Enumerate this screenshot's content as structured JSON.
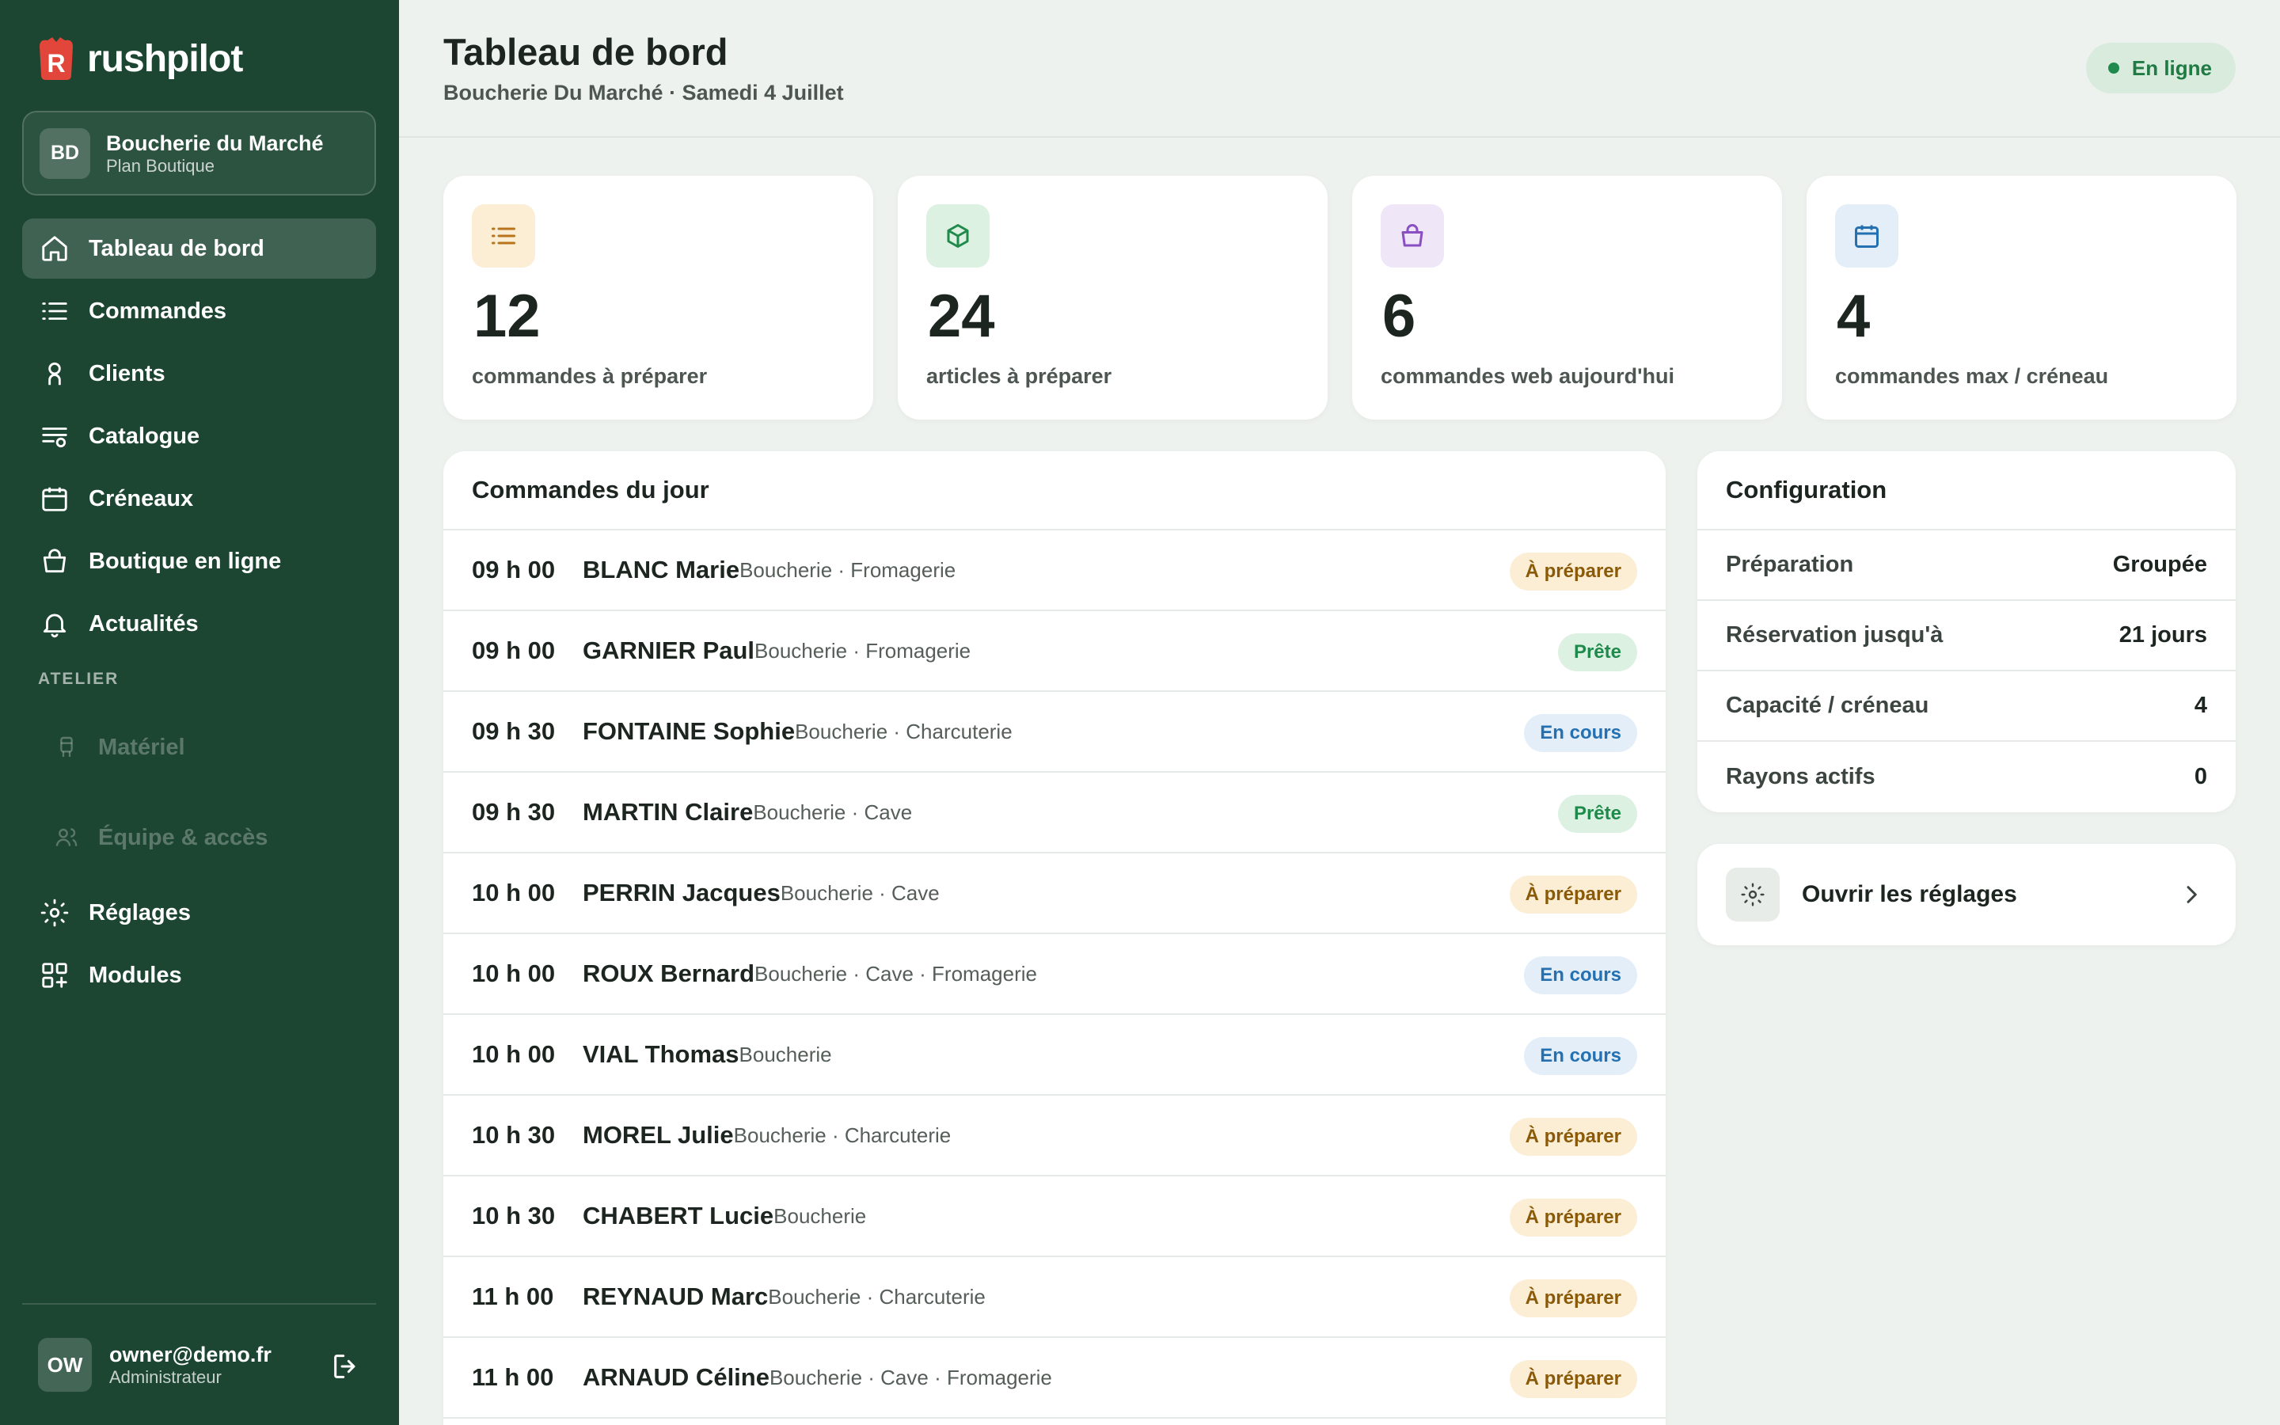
{
  "app": {
    "brand": "rushpilot"
  },
  "store": {
    "initials": "BD",
    "name": "Boucherie du Marché",
    "plan": "Plan Boutique"
  },
  "nav": {
    "items": [
      {
        "label": "Tableau de bord",
        "icon": "home-icon"
      },
      {
        "label": "Commandes",
        "icon": "list-icon"
      },
      {
        "label": "Clients",
        "icon": "user-icon"
      },
      {
        "label": "Catalogue",
        "icon": "catalog-icon"
      },
      {
        "label": "Créneaux",
        "icon": "calendar-icon"
      },
      {
        "label": "Boutique en ligne",
        "icon": "shopping-bag-icon"
      },
      {
        "label": "Actualités",
        "icon": "bell-icon"
      }
    ],
    "section": "ATELIER",
    "disabled_items": [
      {
        "label": "Matériel",
        "icon": "equipment-icon"
      },
      {
        "label": "Équipe & accès",
        "icon": "team-icon"
      }
    ],
    "bottom_items": [
      {
        "label": "Réglages",
        "icon": "settings-icon"
      },
      {
        "label": "Modules",
        "icon": "modules-icon"
      }
    ]
  },
  "user": {
    "initials": "OW",
    "email": "owner@demo.fr",
    "role": "Administrateur"
  },
  "header": {
    "title": "Tableau de bord",
    "subtitle": "Boucherie Du Marché · Samedi 4 Juillet",
    "status": "En ligne"
  },
  "stats": [
    {
      "value": "12",
      "label": "commandes à préparer",
      "icon": "list-icon",
      "bg": "#fbeed5",
      "color": "#b8741a"
    },
    {
      "value": "24",
      "label": "articles à préparer",
      "icon": "box-icon",
      "bg": "#dcf1e2",
      "color": "#1f8a4b"
    },
    {
      "value": "6",
      "label": "commandes web aujourd'hui",
      "icon": "shopping-bag-icon",
      "bg": "#efe6f7",
      "color": "#8a4fc2"
    },
    {
      "value": "4",
      "label": "commandes max / créneau",
      "icon": "calendar-icon",
      "bg": "#e3eef8",
      "color": "#2470b0"
    }
  ],
  "orders": {
    "title": "Commandes du jour",
    "rows": [
      {
        "time": "09 h 00",
        "name": "BLANC Marie",
        "categories": "Boucherie · Fromagerie",
        "status": "À préparer",
        "status_type": "prep"
      },
      {
        "time": "09 h 00",
        "name": "GARNIER Paul",
        "categories": "Boucherie · Fromagerie",
        "status": "Prête",
        "status_type": "ready"
      },
      {
        "time": "09 h 30",
        "name": "FONTAINE Sophie",
        "categories": "Boucherie · Charcuterie",
        "status": "En cours",
        "status_type": "progress"
      },
      {
        "time": "09 h 30",
        "name": "MARTIN Claire",
        "categories": "Boucherie · Cave",
        "status": "Prête",
        "status_type": "ready"
      },
      {
        "time": "10 h 00",
        "name": "PERRIN Jacques",
        "categories": "Boucherie · Cave",
        "status": "À préparer",
        "status_type": "prep"
      },
      {
        "time": "10 h 00",
        "name": "ROUX Bernard",
        "categories": "Boucherie · Cave · Fromagerie",
        "status": "En cours",
        "status_type": "progress"
      },
      {
        "time": "10 h 00",
        "name": "VIAL Thomas",
        "categories": "Boucherie",
        "status": "En cours",
        "status_type": "progress"
      },
      {
        "time": "10 h 30",
        "name": "MOREL Julie",
        "categories": "Boucherie · Charcuterie",
        "status": "À préparer",
        "status_type": "prep"
      },
      {
        "time": "10 h 30",
        "name": "CHABERT Lucie",
        "categories": "Boucherie",
        "status": "À préparer",
        "status_type": "prep"
      },
      {
        "time": "11 h 00",
        "name": "REYNAUD Marc",
        "categories": "Boucherie · Charcuterie",
        "status": "À préparer",
        "status_type": "prep"
      },
      {
        "time": "11 h 00",
        "name": "ARNAUD Céline",
        "categories": "Boucherie · Cave · Fromagerie",
        "status": "À préparer",
        "status_type": "prep"
      }
    ]
  },
  "config": {
    "title": "Configuration",
    "rows": [
      {
        "label": "Préparation",
        "value": "Groupée"
      },
      {
        "label": "Réservation jusqu'à",
        "value": "21 jours"
      },
      {
        "label": "Capacité / créneau",
        "value": "4"
      },
      {
        "label": "Rayons actifs",
        "value": "0"
      }
    ]
  },
  "settings_card": {
    "label": "Ouvrir les réglages"
  },
  "colors": {
    "sidebar": "#1c4532",
    "accent_red": "#e2453a",
    "online_green": "#1f8a4b"
  }
}
